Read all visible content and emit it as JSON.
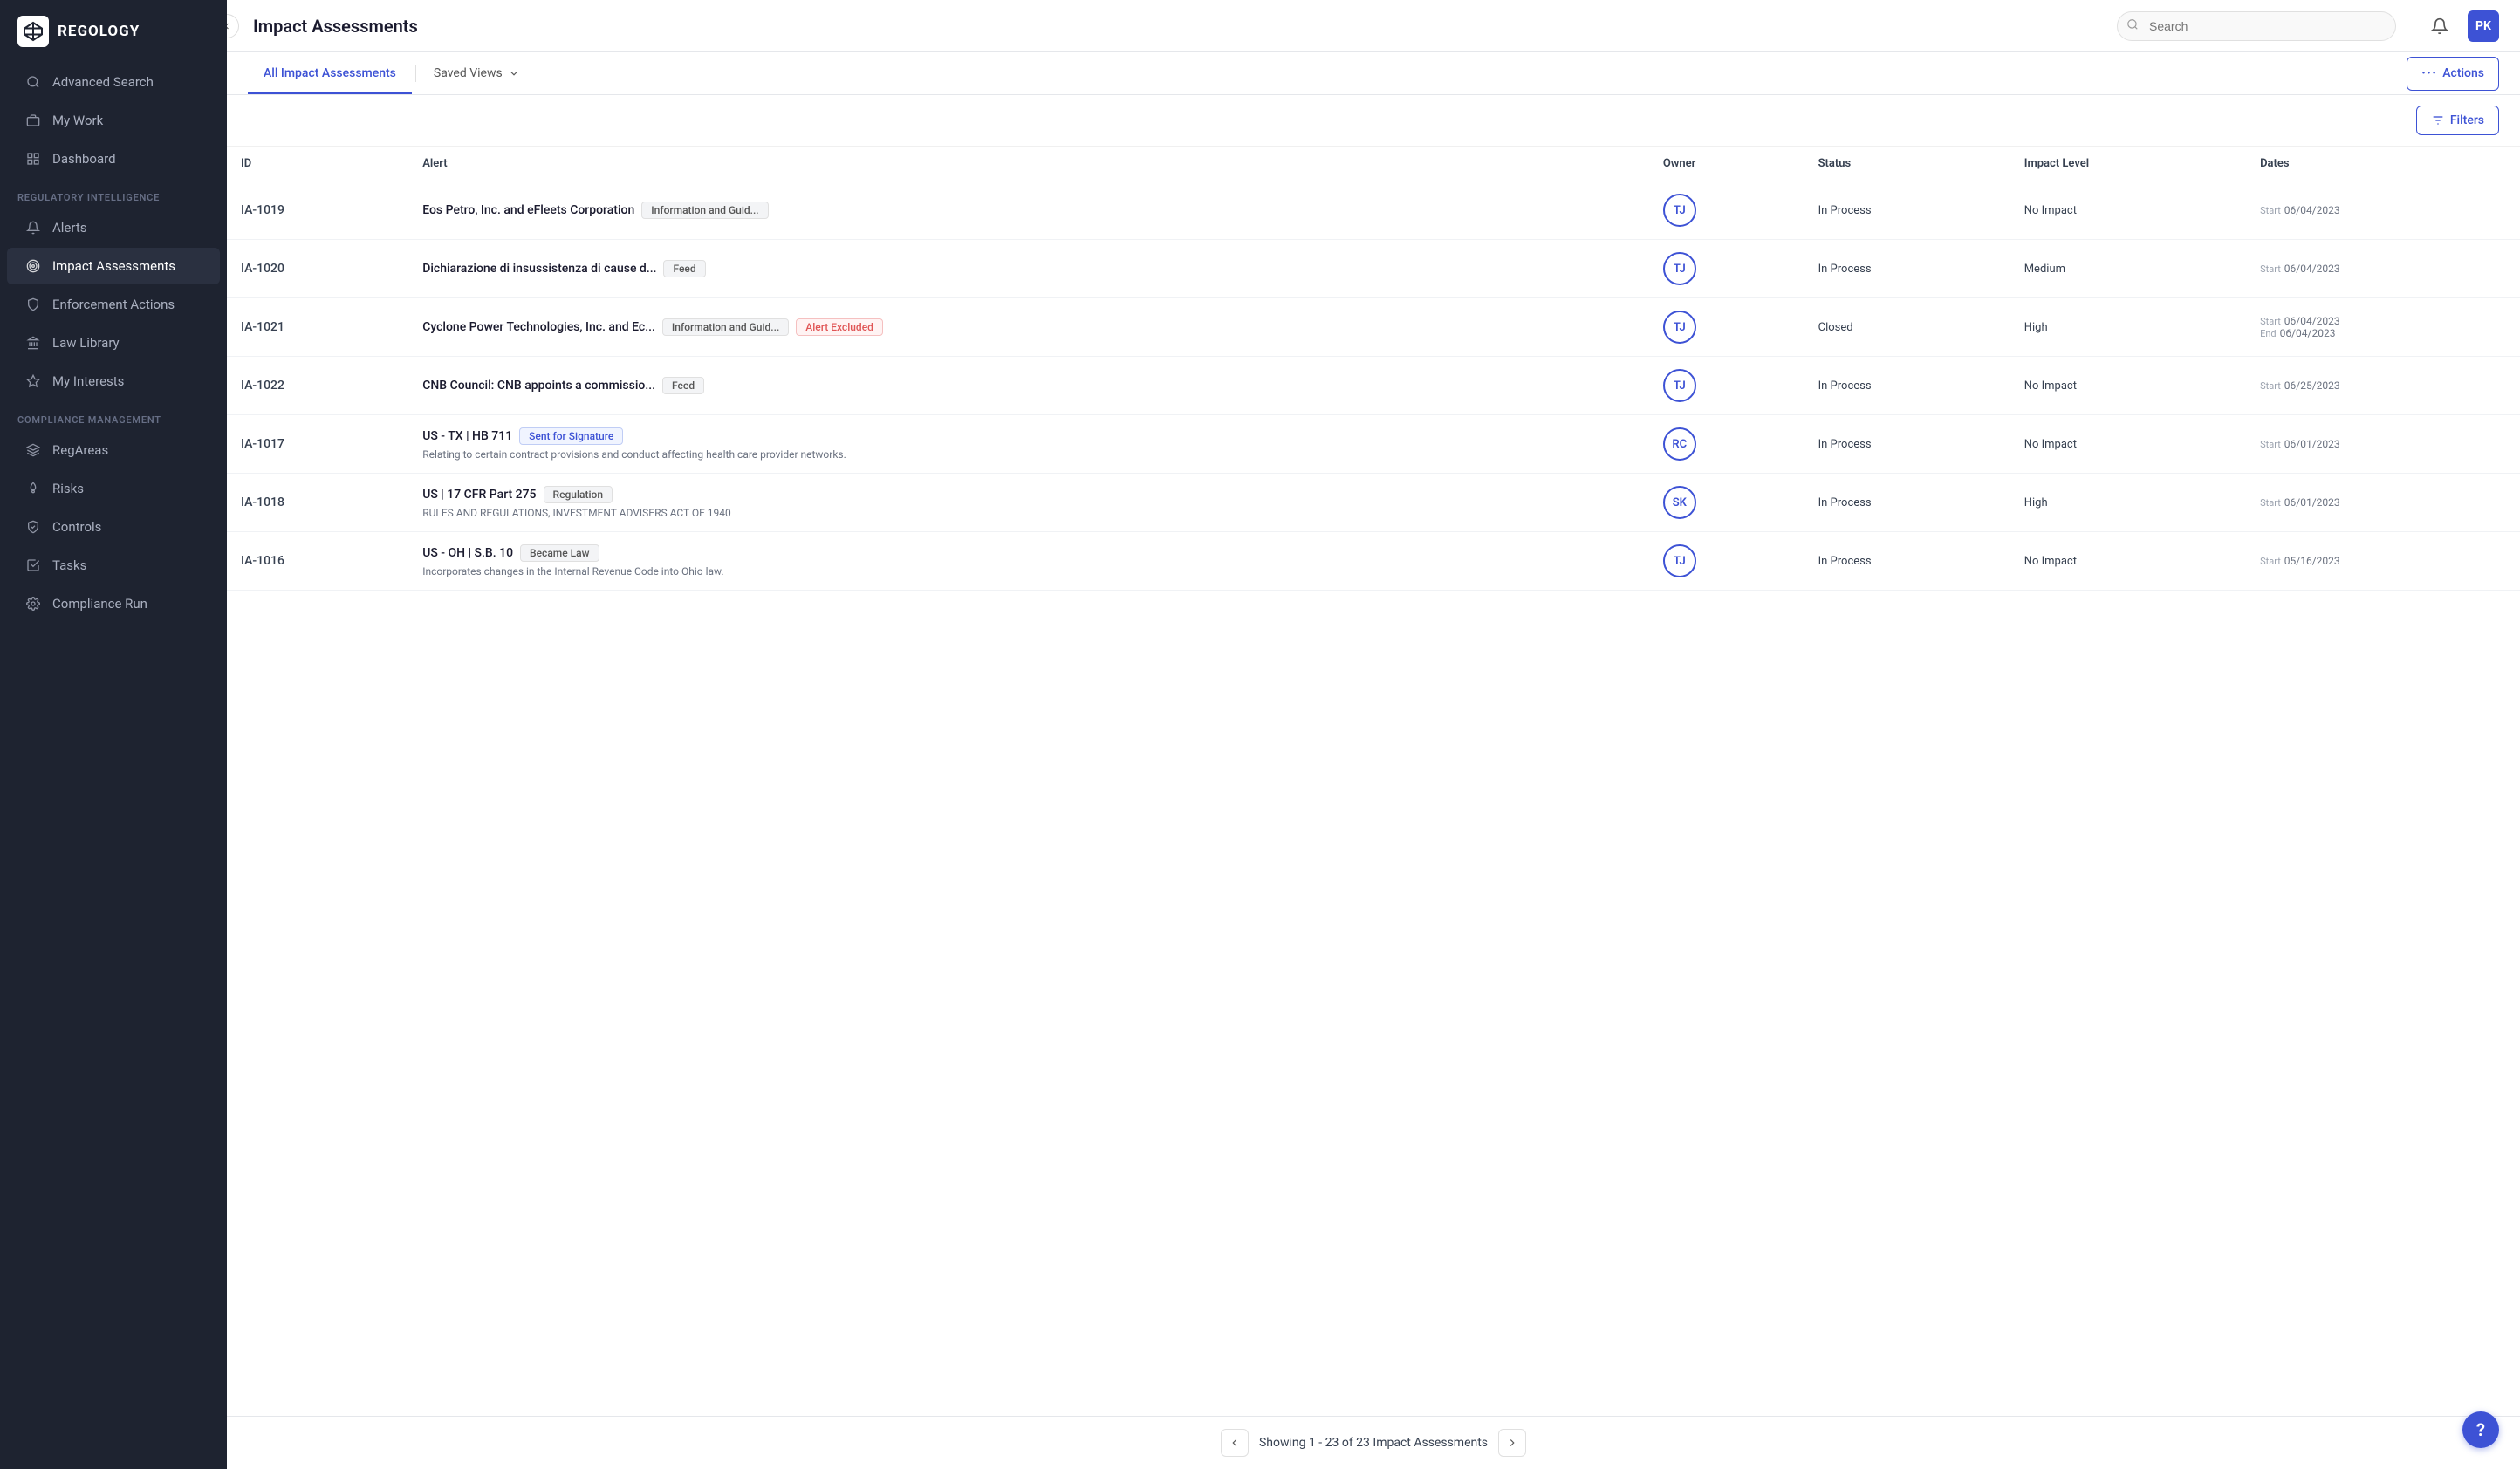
{
  "sidebar": {
    "logo_text": "REGOLOGY",
    "items_top": [
      {
        "id": "advanced-search",
        "label": "Advanced Search",
        "icon": "search"
      },
      {
        "id": "my-work",
        "label": "My Work",
        "icon": "briefcase"
      },
      {
        "id": "dashboard",
        "label": "Dashboard",
        "icon": "grid"
      }
    ],
    "section1_label": "REGULATORY INTELLIGENCE",
    "items_section1": [
      {
        "id": "alerts",
        "label": "Alerts",
        "icon": "bell"
      },
      {
        "id": "impact-assessments",
        "label": "Impact Assessments",
        "icon": "target",
        "active": true
      },
      {
        "id": "enforcement-actions",
        "label": "Enforcement Actions",
        "icon": "shield"
      },
      {
        "id": "law-library",
        "label": "Law Library",
        "icon": "bank"
      },
      {
        "id": "my-interests",
        "label": "My Interests",
        "icon": "star"
      }
    ],
    "section2_label": "COMPLIANCE MANAGEMENT",
    "items_section2": [
      {
        "id": "reg-areas",
        "label": "RegAreas",
        "icon": "layers"
      },
      {
        "id": "risks",
        "label": "Risks",
        "icon": "flame"
      },
      {
        "id": "controls",
        "label": "Controls",
        "icon": "shield-check"
      },
      {
        "id": "tasks",
        "label": "Tasks",
        "icon": "check-square"
      },
      {
        "id": "compliance-run",
        "label": "Compliance Run",
        "icon": "gear"
      }
    ]
  },
  "topbar": {
    "title": "Impact Assessments",
    "search_placeholder": "Search",
    "avatar_initials": "PK"
  },
  "tabs": {
    "all_label": "All Impact Assessments",
    "saved_views_label": "Saved Views",
    "actions_label": "Actions"
  },
  "filters_label": "Filters",
  "table": {
    "columns": [
      "ID",
      "Alert",
      "Owner",
      "Status",
      "Impact Level",
      "Dates"
    ],
    "rows": [
      {
        "id": "IA-1019",
        "alert_title": "Eos Petro, Inc. and eFleets Corporation",
        "alert_tags": [
          {
            "label": "Information and Guid...",
            "type": "default"
          }
        ],
        "alert_subtitle": "",
        "owner_initials": "TJ",
        "status": "In Process",
        "impact_level": "No Impact",
        "dates": [
          {
            "label": "Start",
            "value": "06/04/2023"
          }
        ]
      },
      {
        "id": "IA-1020",
        "alert_title": "Dichiarazione di insussistenza di cause d...",
        "alert_tags": [
          {
            "label": "Feed",
            "type": "default"
          }
        ],
        "alert_subtitle": "",
        "owner_initials": "TJ",
        "status": "In Process",
        "impact_level": "Medium",
        "dates": [
          {
            "label": "Start",
            "value": "06/04/2023"
          }
        ]
      },
      {
        "id": "IA-1021",
        "alert_title": "Cyclone Power Technologies, Inc. and Ec...",
        "alert_tags": [
          {
            "label": "Information and Guid...",
            "type": "default"
          },
          {
            "label": "Alert Excluded",
            "type": "excluded"
          }
        ],
        "alert_subtitle": "",
        "owner_initials": "TJ",
        "status": "Closed",
        "impact_level": "High",
        "dates": [
          {
            "label": "Start",
            "value": "06/04/2023"
          },
          {
            "label": "End",
            "value": "06/04/2023"
          }
        ]
      },
      {
        "id": "IA-1022",
        "alert_title": "CNB Council: CNB appoints a commissio...",
        "alert_tags": [
          {
            "label": "Feed",
            "type": "default"
          }
        ],
        "alert_subtitle": "",
        "owner_initials": "TJ",
        "status": "In Process",
        "impact_level": "No Impact",
        "dates": [
          {
            "label": "Start",
            "value": "06/25/2023"
          }
        ]
      },
      {
        "id": "IA-1017",
        "alert_title": "US - TX | HB 711",
        "alert_tags": [
          {
            "label": "Sent for Signature",
            "type": "sent"
          }
        ],
        "alert_subtitle": "Relating to certain contract provisions and conduct affecting health care provider networks.",
        "owner_initials": "RC",
        "status": "In Process",
        "impact_level": "No Impact",
        "dates": [
          {
            "label": "Start",
            "value": "06/01/2023"
          }
        ]
      },
      {
        "id": "IA-1018",
        "alert_title": "US | 17 CFR Part 275",
        "alert_tags": [
          {
            "label": "Regulation",
            "type": "default"
          }
        ],
        "alert_subtitle": "RULES AND REGULATIONS, INVESTMENT ADVISERS ACT OF 1940",
        "owner_initials": "SK",
        "status": "In Process",
        "impact_level": "High",
        "dates": [
          {
            "label": "Start",
            "value": "06/01/2023"
          }
        ]
      },
      {
        "id": "IA-1016",
        "alert_title": "US - OH | S.B. 10",
        "alert_tags": [
          {
            "label": "Became Law",
            "type": "default"
          }
        ],
        "alert_subtitle": "Incorporates changes in the Internal Revenue Code into Ohio law.",
        "owner_initials": "TJ",
        "status": "In Process",
        "impact_level": "No Impact",
        "dates": [
          {
            "label": "Start",
            "value": "05/16/2023"
          }
        ]
      }
    ]
  },
  "pagination": {
    "text": "Showing 1 - 23 of 23 Impact Assessments"
  }
}
